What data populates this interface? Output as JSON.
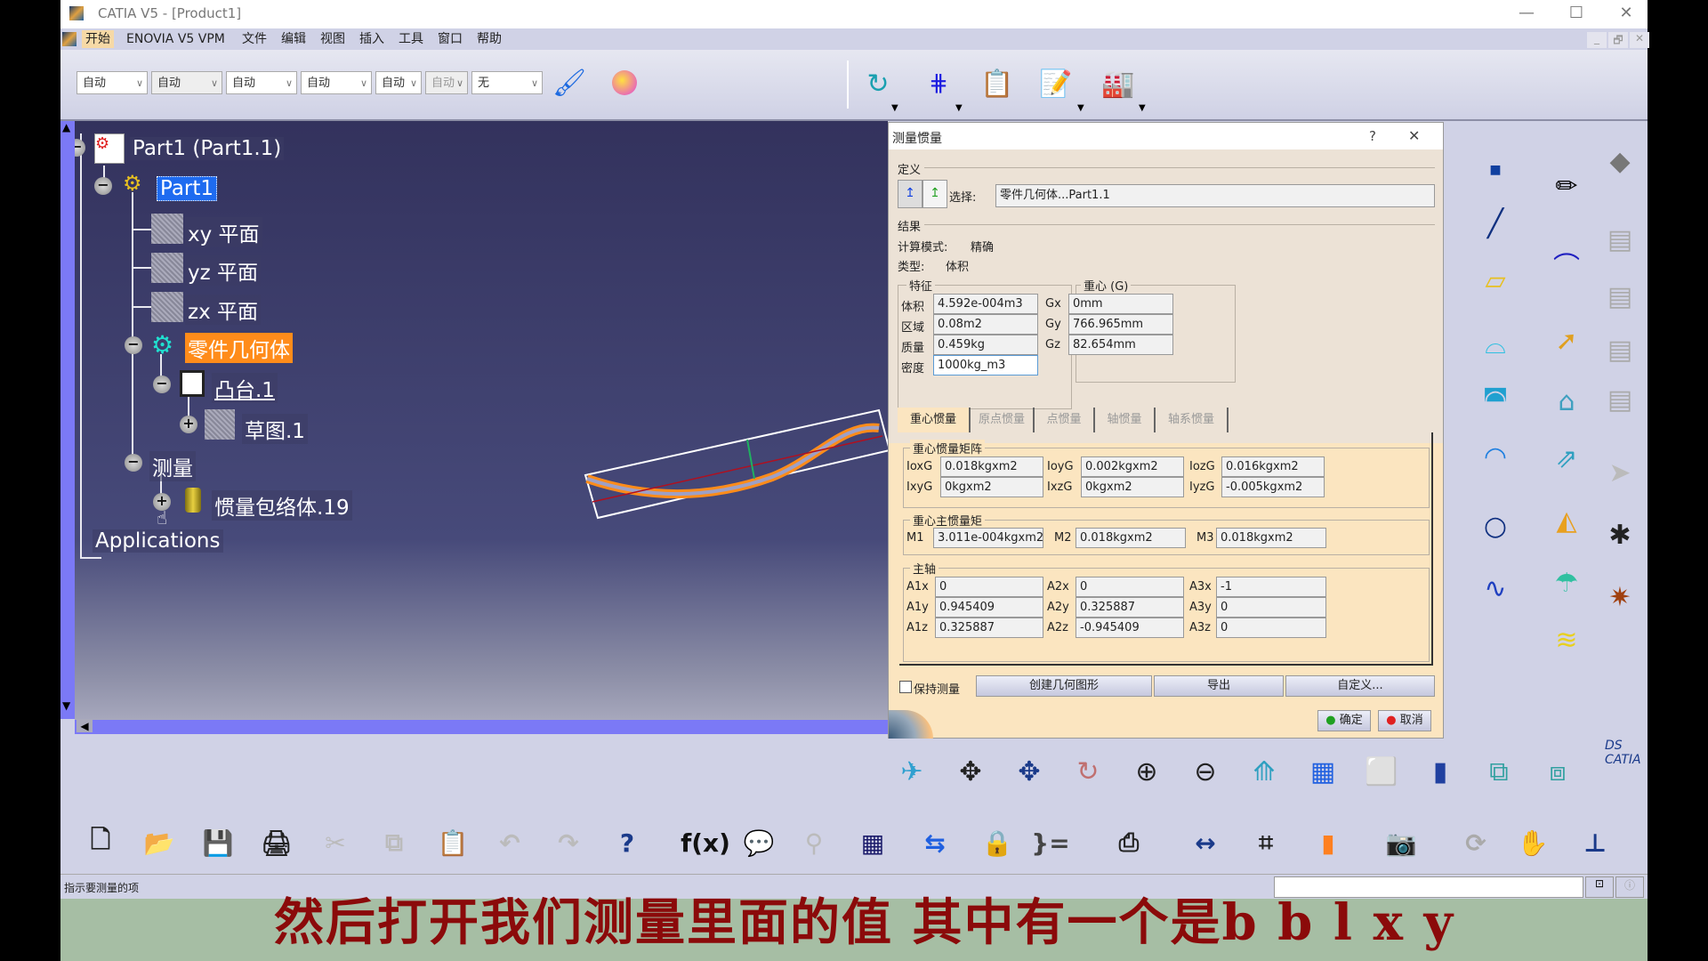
{
  "window": {
    "title": "CATIA V5 - [Product1]",
    "controls": {
      "minimize": "—",
      "maximize": "☐",
      "close": "✕"
    },
    "mdi_controls": {
      "minimize": "_",
      "restore": "🗗",
      "close": "✕"
    }
  },
  "menubar": {
    "items": [
      "开始",
      "ENOVIA V5 VPM",
      "文件",
      "编辑",
      "视图",
      "插入",
      "工具",
      "窗口",
      "帮助"
    ],
    "active_index": 0
  },
  "toolbar_top": {
    "combos": [
      {
        "value": "自动",
        "disabled": false
      },
      {
        "value": "自动",
        "disabled": false
      },
      {
        "value": "自动",
        "disabled": false
      },
      {
        "value": "自动",
        "disabled": false
      },
      {
        "value": "自动",
        "disabled": false
      },
      {
        "value": "自动",
        "disabled": true
      },
      {
        "value": "无",
        "disabled": false
      }
    ],
    "icons": [
      "painter-brush-icon",
      "apply-material-icon",
      "repeat-xN-icon",
      "grid-pattern-icon",
      "clipboard-paste-icon",
      "sketch-edit-icon",
      "factory-icon"
    ]
  },
  "tree": {
    "root": "Part1 (Part1.1)",
    "part": "Part1",
    "planes": [
      "xy 平面",
      "yz 平面",
      "zx 平面"
    ],
    "body": "零件几何体",
    "pad": "凸台.1",
    "sketch": "草图.1",
    "measure": "测量",
    "inertia": "惯量包络体.19",
    "applications": "Applications"
  },
  "dialog": {
    "title": "测量惯量",
    "help": "?",
    "close": "✕",
    "definition_label": "定义",
    "select_label": "选择:",
    "select_value": "零件几何体...Part1.1",
    "result_label": "结果",
    "calc_mode_label": "计算模式:",
    "calc_mode_value": "精确",
    "type_label": "类型:",
    "type_value": "体积",
    "characteristics": {
      "label": "特征",
      "rows": [
        {
          "label": "体积",
          "value": "4.592e-004m3"
        },
        {
          "label": "区域",
          "value": "0.08m2"
        },
        {
          "label": "质量",
          "value": "0.459kg"
        },
        {
          "label": "密度",
          "value": "1000kg_m3"
        }
      ]
    },
    "cog": {
      "label": "重心 (G)",
      "rows": [
        {
          "label": "Gx",
          "value": "0mm"
        },
        {
          "label": "Gy",
          "value": "766.965mm"
        },
        {
          "label": "Gz",
          "value": "82.654mm"
        }
      ]
    },
    "tabs": [
      "重心惯量",
      "原点惯量",
      "点惯量",
      "轴惯量",
      "轴系惯量"
    ],
    "active_tab": 0,
    "matrix": {
      "label": "重心惯量矩阵",
      "rows": [
        [
          {
            "label": "IoxG",
            "value": "0.018kgxm2"
          },
          {
            "label": "IoyG",
            "value": "0.002kgxm2"
          },
          {
            "label": "IozG",
            "value": "0.016kgxm2"
          }
        ],
        [
          {
            "label": "IxyG",
            "value": "0kgxm2"
          },
          {
            "label": "IxzG",
            "value": "0kgxm2"
          },
          {
            "label": "IyzG",
            "value": "-0.005kgxm2"
          }
        ]
      ]
    },
    "principal_moments": {
      "label": "重心主惯量矩",
      "rows": [
        [
          {
            "label": "M1",
            "value": "3.011e-004kgxm2"
          },
          {
            "label": "M2",
            "value": "0.018kgxm2"
          },
          {
            "label": "M3",
            "value": "0.018kgxm2"
          }
        ]
      ]
    },
    "principal_axes": {
      "label": "主轴",
      "rows": [
        [
          {
            "label": "A1x",
            "value": "0"
          },
          {
            "label": "A2x",
            "value": "0"
          },
          {
            "label": "A3x",
            "value": "-1"
          }
        ],
        [
          {
            "label": "A1y",
            "value": "0.945409"
          },
          {
            "label": "A2y",
            "value": "0.325887"
          },
          {
            "label": "A3y",
            "value": "0"
          }
        ],
        [
          {
            "label": "A1z",
            "value": "0.325887"
          },
          {
            "label": "A2z",
            "value": "-0.945409"
          },
          {
            "label": "A3z",
            "value": "0"
          }
        ]
      ]
    },
    "keep_measure_label": "保持测量",
    "keep_measure_checked": false,
    "create_geometry": "创建几何图形",
    "export": "导出",
    "customize": "自定义...",
    "ok": "确定",
    "cancel": "取消"
  },
  "status": {
    "message": "指示要测量的项"
  },
  "subtitle": "然后打开我们测量里面的值 其中有一个是b b l x y",
  "colors": {
    "viewport_top": "#33325d",
    "tree_highlight_selected": "#1e6bf0",
    "tree_highlight_body": "#ff8c1a",
    "dialog_bg": "#fbe5c0",
    "subtitle_color": "#8b0a0a",
    "subtitle_band": "#a6bea4"
  }
}
